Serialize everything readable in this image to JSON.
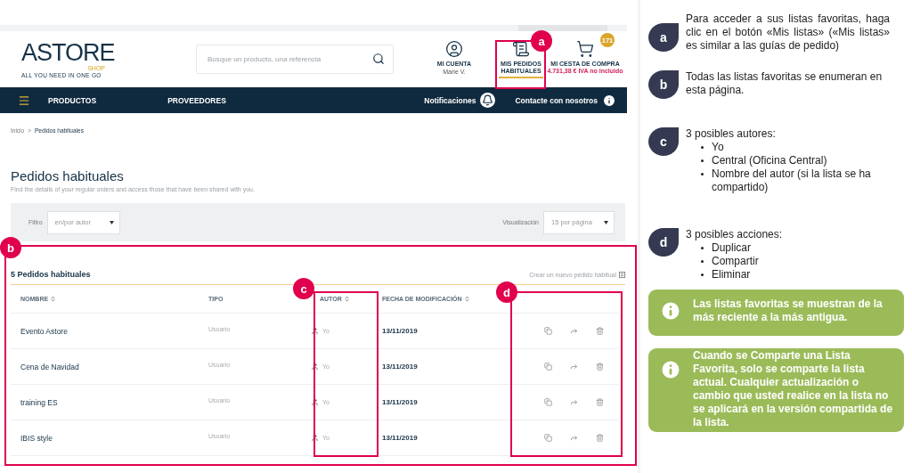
{
  "header": {
    "logo": {
      "word": "ASTORE",
      "sub": "SHOP",
      "tagline": "ALL YOU NEED IN ONE GO"
    },
    "search": {
      "placeholder": "Busque un producto, una referencia"
    },
    "account": {
      "label": "MI CUENTA",
      "user": "Marie V."
    },
    "orders": {
      "label": "MIS PEDIDOS HABITUALES",
      "selected": true
    },
    "cart": {
      "label": "MI CESTA DE COMPRA",
      "total": "4.731,38 € IVA no incluido",
      "count": "171"
    }
  },
  "nav": {
    "items": [
      {
        "label": "PRODUCTOS"
      },
      {
        "label": "PROVEEDORES"
      }
    ],
    "right": [
      {
        "label": "Notificaciones",
        "kind": "bell"
      },
      {
        "label": "Contacte con nosotros",
        "kind": "info"
      }
    ]
  },
  "breadcrumb": {
    "home": "Inicio",
    "separator": ">",
    "current": "Pedidos habituales"
  },
  "page": {
    "title": "Pedidos habituales",
    "subtitle": "Find the details of your regular orders and access those that have been shared with you."
  },
  "filters": {
    "filter_label": "Filtro",
    "filter_value": "en/por autor",
    "view_label": "Visualización",
    "view_value": "15 por página"
  },
  "list": {
    "count_title": "5 Pedidos habituales",
    "create_link": "Crear un nuevo pedido habitual",
    "columns": [
      {
        "label": "NOMBRE",
        "sortable": true
      },
      {
        "label": "TIPO",
        "sortable": false
      },
      {
        "label": "AUTOR",
        "sortable": true
      },
      {
        "label": "FECHA DE MODIFICACIÓN",
        "sortable": true
      }
    ],
    "rows": [
      {
        "name": "Evento Astore",
        "type": "Usuario",
        "author": "Yo",
        "date": "13/11/2019"
      },
      {
        "name": "Cena de Navidad",
        "type": "Usuario",
        "author": "Yo",
        "date": "13/11/2019"
      },
      {
        "name": "training ES",
        "type": "Usuario",
        "author": "Yo",
        "date": "13/11/2019"
      },
      {
        "name": "IBIS style",
        "type": "Usuario",
        "author": "Yo",
        "date": "13/11/2019"
      }
    ]
  },
  "markers": [
    {
      "letter": "a"
    },
    {
      "letter": "b"
    },
    {
      "letter": "c"
    },
    {
      "letter": "d"
    }
  ],
  "callouts": [
    {
      "letter": "a",
      "text": "Para acceder a sus listas favoritas, haga clic en el botón «Mis listas» («Mis listas» es similar a las guías de pedido)"
    },
    {
      "letter": "b",
      "text": "Todas las listas favoritas se enumeran en esta página."
    },
    {
      "letter": "c",
      "text": "3 posibles autores:",
      "items": [
        "Yo",
        "Central (Oficina Central)",
        "Nombre del autor (si la lista se ha compartido)"
      ]
    },
    {
      "letter": "d",
      "text": "3 posibles acciones:",
      "items": [
        "Duplicar",
        "Compartir",
        "Eliminar"
      ]
    }
  ],
  "notes": [
    {
      "text": "Las listas favoritas se muestran de la más reciente a la más antigua."
    },
    {
      "text": "Cuando se Comparte una Lista Favorita, solo se comparte la lista actual. Cualquier actualización o cambio que usted realice en la lista no se aplicará en la versión compartida de la lista."
    }
  ]
}
